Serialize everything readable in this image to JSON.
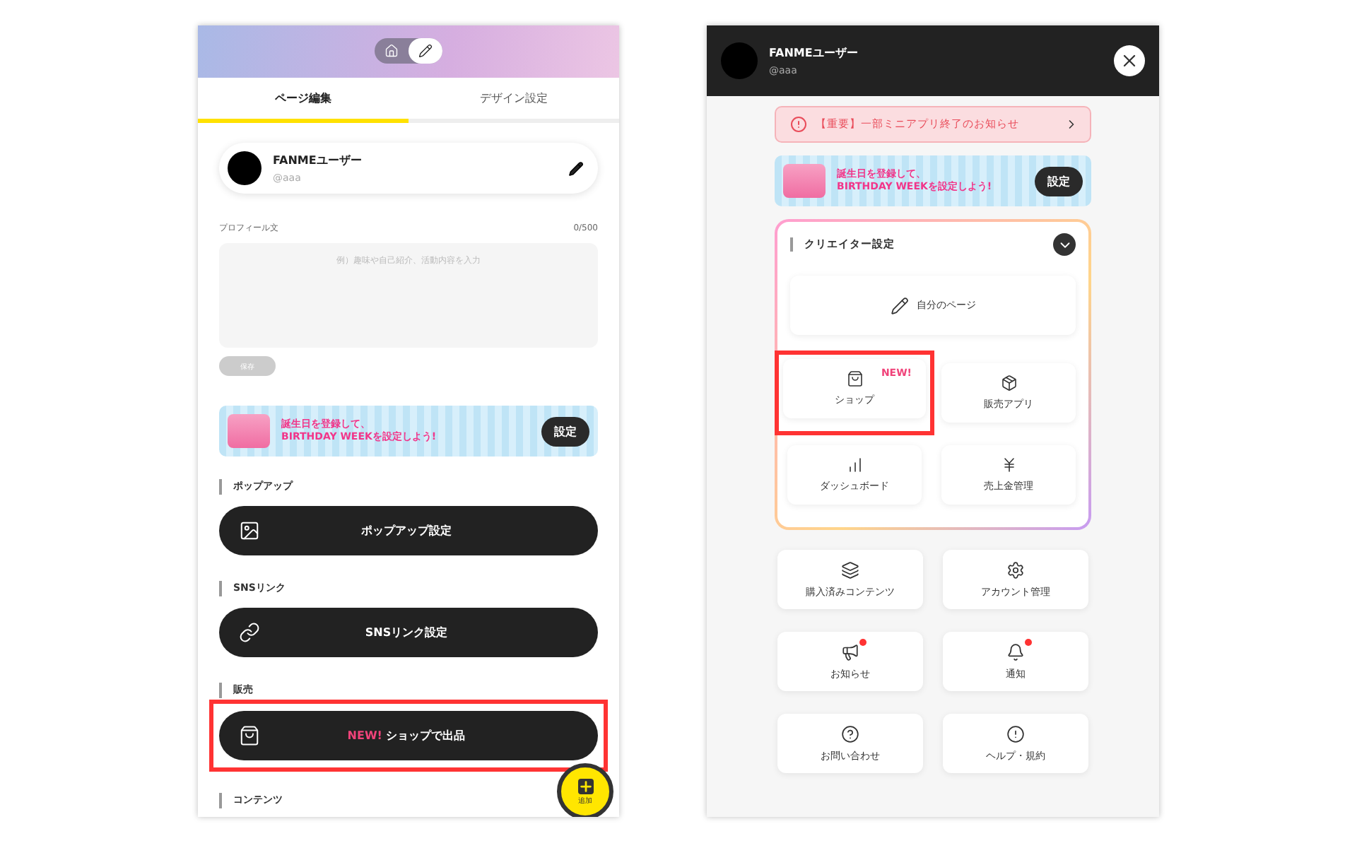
{
  "editor": {
    "mode_toggle": [
      {
        "kind": "home",
        "selected": false
      },
      {
        "kind": "edit",
        "selected": true
      }
    ],
    "tabs": [
      {
        "label": "ページ編集",
        "selected": true
      },
      {
        "label": "デザイン設定",
        "selected": false
      }
    ],
    "profile": {
      "name": "FANMEユーザー",
      "handle": "@aaa"
    },
    "bio": {
      "label": "プロフィール文",
      "counter": "0/500",
      "placeholder": "例）趣味や自己紹介、活動内容を入力"
    },
    "save_button": "保存",
    "banner": {
      "lines": [
        "誕生日を登録して、",
        "BIRTHDAY WEEKを設定しよう!"
      ],
      "button": "設定"
    },
    "sections": [
      {
        "title": "ポップアップ",
        "button": {
          "kind": "popup",
          "label": "ポップアップ設定",
          "highlighted": false
        }
      },
      {
        "title": "SNSリンク",
        "button": {
          "kind": "link",
          "label": "SNSリンク設定",
          "highlighted": false
        }
      },
      {
        "title": "販売",
        "button": {
          "kind": "shop",
          "badge": "NEW!",
          "label": "ショップで出品",
          "highlighted": true
        }
      },
      {
        "title": "コンテンツ"
      }
    ],
    "fab": {
      "label": "追加"
    }
  },
  "menu": {
    "profile": {
      "name": "FANMEユーザー",
      "handle": "@aaa"
    },
    "notice": {
      "text": "【重要】一部ミニアプリ終了のお知らせ"
    },
    "banner": {
      "lines": [
        "誕生日を登録して、",
        "BIRTHDAY WEEKを設定しよう!"
      ],
      "button": "設定"
    },
    "creator": {
      "title": "クリエイター設定",
      "expanded": true,
      "wide_tile": {
        "kind": "pencil",
        "label": "自分のページ"
      },
      "tiles": [
        {
          "kind": "shop",
          "label": "ショップ",
          "badge": "NEW!",
          "highlighted": true
        },
        {
          "kind": "app",
          "label": "販売アプリ",
          "highlighted": false
        },
        {
          "kind": "chart",
          "label": "ダッシュボード",
          "highlighted": false
        },
        {
          "kind": "money",
          "label": "売上金管理",
          "highlighted": false
        }
      ]
    },
    "tiles": [
      {
        "kind": "layers",
        "label": "購入済みコンテンツ",
        "unread": false
      },
      {
        "kind": "gear",
        "label": "アカウント管理",
        "unread": false
      },
      {
        "kind": "megaphone",
        "label": "お知らせ",
        "unread": true
      },
      {
        "kind": "bell",
        "label": "通知",
        "unread": true
      },
      {
        "kind": "help",
        "label": "お問い合わせ",
        "unread": false
      },
      {
        "kind": "alert",
        "label": "ヘルプ・規約",
        "unread": false
      }
    ]
  }
}
